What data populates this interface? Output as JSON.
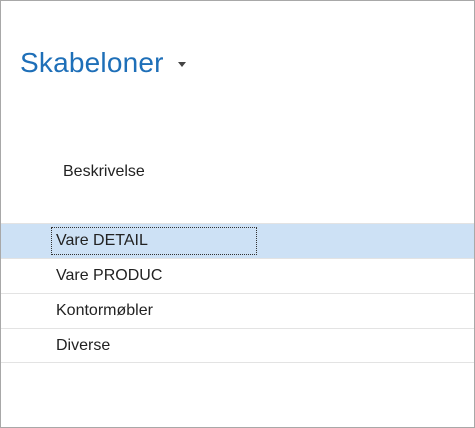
{
  "header": {
    "title": "Skabeloner"
  },
  "table": {
    "column_header": "Beskrivelse",
    "rows": [
      {
        "label": "Vare DETAIL",
        "selected": true
      },
      {
        "label": "Vare PRODUC",
        "selected": false
      },
      {
        "label": "Kontormøbler",
        "selected": false
      },
      {
        "label": "Diverse",
        "selected": false
      }
    ]
  }
}
